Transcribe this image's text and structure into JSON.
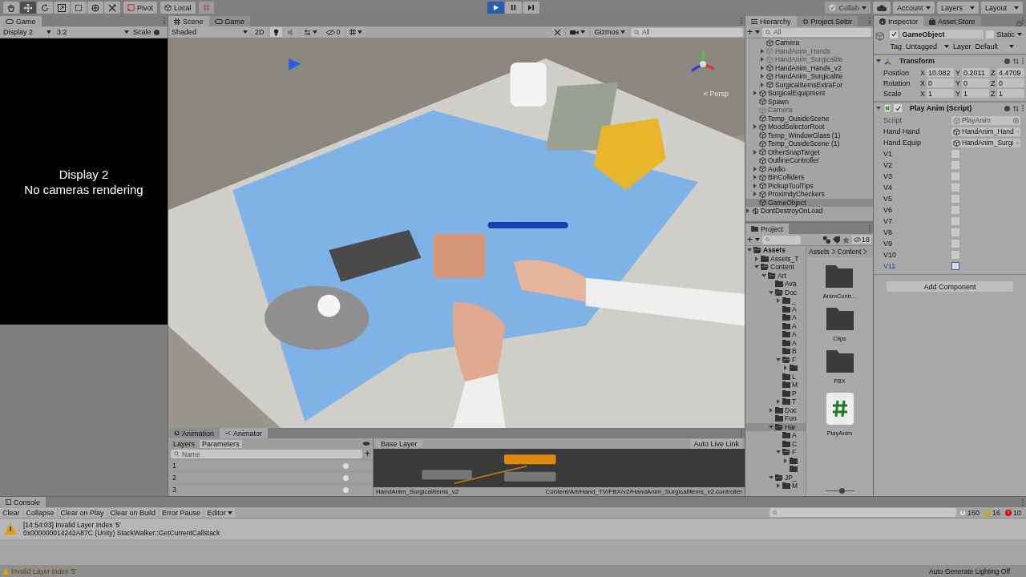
{
  "toolbar": {
    "tools": [
      {
        "kind": "hand",
        "selected": false
      },
      {
        "kind": "move",
        "selected": true
      },
      {
        "kind": "rotate",
        "selected": false
      },
      {
        "kind": "scale",
        "selected": false
      },
      {
        "kind": "rect",
        "selected": false
      },
      {
        "kind": "transform",
        "selected": false
      },
      {
        "kind": "custom",
        "selected": false
      }
    ],
    "pivot": "Pivot",
    "local": "Local",
    "playing": true,
    "paused": false,
    "collab": "Collab",
    "account": "Account",
    "layers": "Layers",
    "layout": "Layout"
  },
  "game": {
    "tab": "Game",
    "display": "Display 2",
    "aspect": "3:2",
    "scale_label": "Scale",
    "message": [
      "Display 2",
      "No cameras rendering"
    ]
  },
  "scene": {
    "tabs": [
      {
        "label": "Scene",
        "kind": "scene",
        "selected": true
      },
      {
        "label": "Game",
        "kind": "game",
        "selected": false
      }
    ],
    "shading": "Shaded",
    "mode_2d": "2D",
    "hidden_count": "0",
    "gizmos": "Gizmos",
    "search": {
      "placeholder": "All"
    },
    "orientation": "< Persp"
  },
  "hierarchy": {
    "tabs": [
      {
        "label": "Hierarchy",
        "kind": "list",
        "selected": true
      },
      {
        "label": "Project Settir",
        "kind": "gear",
        "selected": false
      }
    ],
    "create_button": "+",
    "search": {
      "placeholder": "All"
    },
    "tree": [
      {
        "children": [
          {
            "children": [
              {
                "label": "Camera",
                "active": true,
                "selected": false
              },
              {
                "label": "HandAnim_Hands",
                "active": false,
                "selected": false,
                "expanded": false
              },
              {
                "label": "HandAnim_SurgicalIte",
                "active": false,
                "selected": false,
                "expanded": false
              },
              {
                "label": "HandAnim_Hands_v2",
                "active": true,
                "selected": false,
                "expanded": false
              },
              {
                "label": "HandAnim_SurgicalIte",
                "active": true,
                "selected": false,
                "expanded": false
              },
              {
                "label": "SurgicalItemsExtraFor",
                "active": true,
                "selected": false,
                "expanded": false
              }
            ]
          },
          {
            "label": "SurgicalEquipment",
            "active": true,
            "selected": false,
            "expanded": false
          },
          {
            "label": "Spawn",
            "active": true,
            "selected": false
          },
          {
            "label": "Camera",
            "active": false,
            "selected": false
          },
          {
            "label": "Temp_OusideScene",
            "active": true,
            "selected": false
          },
          {
            "label": "MoodSelectorRoot",
            "active": true,
            "selected": false,
            "expanded": false
          },
          {
            "label": "Temp_WindowGlass (1)",
            "active": true,
            "selected": false
          },
          {
            "label": "Temp_OusideScene (1)",
            "active": true,
            "selected": false
          },
          {
            "label": "OtherSnapTarget",
            "active": true,
            "selected": false,
            "expanded": false
          },
          {
            "label": "OutlineController",
            "active": true,
            "selected": false
          },
          {
            "label": "Audio",
            "active": true,
            "selected": false,
            "expanded": false
          },
          {
            "label": "BinColliders",
            "active": true,
            "selected": false,
            "expanded": false
          },
          {
            "label": "PickupToolTips",
            "active": true,
            "selected": false,
            "expanded": false
          },
          {
            "label": "ProximityCheckers",
            "active": true,
            "selected": false,
            "expanded": false
          },
          {
            "label": "GameObject",
            "active": true,
            "selected": true
          }
        ]
      },
      {
        "label": "DontDestroyOnLoad",
        "kind": "scene",
        "active": true,
        "selected": false,
        "expanded": false
      }
    ]
  },
  "inspector": {
    "tabs": [
      {
        "label": "Inspector",
        "kind": "info",
        "selected": true
      },
      {
        "label": "Asset Store",
        "kind": "bag",
        "selected": false
      }
    ],
    "object": {
      "name": "GameObject",
      "active": true,
      "static_label": "Static",
      "static": false,
      "tag_label": "Tag",
      "tag": "Untagged",
      "layer_label": "Layer",
      "layer": "Default"
    },
    "transform": {
      "title": "Transform",
      "rows": [
        {
          "label": "Position",
          "values": [
            {
              "axis": "X",
              "value": "10.082"
            },
            {
              "axis": "Y",
              "value": "0.2011"
            },
            {
              "axis": "Z",
              "value": "4.4709"
            }
          ]
        },
        {
          "label": "Rotation",
          "values": [
            {
              "axis": "X",
              "value": "0"
            },
            {
              "axis": "Y",
              "value": "0"
            },
            {
              "axis": "Z",
              "value": "0"
            }
          ]
        },
        {
          "label": "Scale",
          "values": [
            {
              "axis": "X",
              "value": "1"
            },
            {
              "axis": "Y",
              "value": "1"
            },
            {
              "axis": "Z",
              "value": "1"
            }
          ]
        }
      ]
    },
    "script": {
      "title": "Play Anim (Script)",
      "enabled": true,
      "fields": [
        {
          "label": "Script",
          "value": "PlayAnim",
          "disabled": true
        },
        {
          "label": "Hand Hand",
          "value": "HandAnim_Hand",
          "disabled": false
        },
        {
          "label": "Hand Equip",
          "value": "HandAnim_Surgi",
          "disabled": false
        }
      ],
      "toggles": [
        {
          "label": "V1",
          "checked": false,
          "focused": false
        },
        {
          "label": "V2",
          "checked": false,
          "focused": false
        },
        {
          "label": "V3",
          "checked": false,
          "focused": false
        },
        {
          "label": "V4",
          "checked": false,
          "focused": false
        },
        {
          "label": "V5",
          "checked": false,
          "focused": false
        },
        {
          "label": "V6",
          "checked": false,
          "focused": false
        },
        {
          "label": "V7",
          "checked": false,
          "focused": false
        },
        {
          "label": "V8",
          "checked": false,
          "focused": false
        },
        {
          "label": "V9",
          "checked": false,
          "focused": false
        },
        {
          "label": "V10",
          "checked": false,
          "focused": false
        },
        {
          "label": "V11",
          "checked": false,
          "focused": true
        }
      ]
    },
    "add_component": "Add Component"
  },
  "project": {
    "tab": "Project",
    "create_button": "+",
    "icon_size_slider": {
      "level": 0.6
    },
    "hidden_count": "18",
    "breadcrumb": [
      "Assets",
      "Content"
    ],
    "tree": [
      {
        "label": "Assets",
        "kind": "root",
        "expanded": true,
        "selected": false,
        "children": [
          {
            "label": "Assets_T",
            "expanded": false,
            "selected": false
          },
          {
            "label": "Content",
            "expanded": true,
            "selected": false,
            "children": [
              {
                "label": "Art",
                "expanded": true,
                "selected": false,
                "children": [
                  {
                    "label": "Ava",
                    "selected": false
                  },
                  {
                    "label": "Doc",
                    "expanded": true,
                    "selected": false,
                    "children": [
                      {
                        "label": "_",
                        "expanded": false,
                        "selected": false
                      },
                      {
                        "label": "A",
                        "selected": false
                      },
                      {
                        "label": "A",
                        "selected": false
                      },
                      {
                        "label": "A",
                        "selected": false
                      },
                      {
                        "label": "A",
                        "selected": false
                      },
                      {
                        "label": "A",
                        "selected": false
                      },
                      {
                        "label": "B",
                        "selected": false
                      },
                      {
                        "label": "F",
                        "expanded": true,
                        "selected": false,
                        "children": [
                          {
                            "expanded": false,
                            "selected": false
                          }
                        ]
                      },
                      {
                        "label": "L",
                        "selected": false
                      },
                      {
                        "label": "M",
                        "selected": false
                      },
                      {
                        "label": "P",
                        "selected": false
                      },
                      {
                        "label": "T",
                        "expanded": false,
                        "selected": false
                      }
                    ]
                  },
                  {
                    "label": "Doc",
                    "expanded": false,
                    "selected": false
                  },
                  {
                    "label": "Fon",
                    "selected": false
                  },
                  {
                    "label": "Har",
                    "expanded": true,
                    "selected": true,
                    "children": [
                      {
                        "label": "A",
                        "selected": false
                      },
                      {
                        "label": "C",
                        "selected": false
                      },
                      {
                        "label": "F",
                        "expanded": true,
                        "selected": false,
                        "children": [
                          {
                            "expanded": false,
                            "selected": false
                          },
                          {
                            "selected": false
                          }
                        ]
                      }
                    ]
                  },
                  {
                    "label": "JP_",
                    "expanded": true,
                    "selected": false,
                    "children": [
                      {
                        "label": "M",
                        "expanded": false,
                        "selected": false
                      }
                    ]
                  }
                ]
              }
            ]
          }
        ]
      }
    ],
    "assets": [
      {
        "label": "AnimContr...",
        "kind": "folder"
      },
      {
        "label": "Clips",
        "kind": "folder"
      },
      {
        "label": "FBX",
        "kind": "folder"
      },
      {
        "label": "PlayAnim",
        "kind": "script"
      }
    ]
  },
  "animator": {
    "tabs": [
      {
        "label": "Animation",
        "kind": "animation",
        "selected": false
      },
      {
        "label": "Animator",
        "kind": "animator",
        "selected": true
      }
    ],
    "subtabs": [
      {
        "label": "Layers",
        "selected": false
      },
      {
        "label": "Parameters",
        "selected": true
      }
    ],
    "search": {
      "placeholder": "Name"
    },
    "add_button": "+",
    "parameters": [
      {
        "label": "1"
      },
      {
        "label": "2"
      },
      {
        "label": "3"
      }
    ],
    "layer": "Base Layer",
    "live_link": "Auto Live Link",
    "controller": "HandAnim_SurgicalItems_v2",
    "path": "Content/Art/Hand_TV/FBX/v2/HandAnim_SurgicalItems_v2.controller"
  },
  "console": {
    "tab": "Console",
    "buttons": [
      "Clear",
      "Collapse",
      "Clear on Play",
      "Clear on Build",
      "Error Pause"
    ],
    "editor": "Editor",
    "counts": [
      {
        "kind": "info",
        "count": "150"
      },
      {
        "kind": "warning",
        "count": "16"
      },
      {
        "kind": "error",
        "count": "10"
      }
    ],
    "messages": [
      {
        "kind": "warning",
        "lines": [
          "[14:54:03] Invalid Layer Index '5'",
          "0x000000014242A87C (Unity) StackWalker::GetCurrentCallstack"
        ]
      }
    ]
  },
  "status_bar": {
    "kind": "warning",
    "message": "Invalid Layer Index '5'",
    "right": "Auto Generate Lighting Off"
  }
}
